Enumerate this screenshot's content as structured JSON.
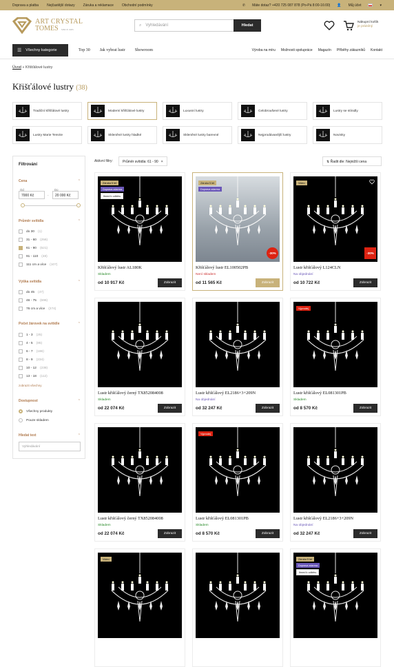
{
  "topbar": {
    "links": [
      "Doprava a platba",
      "Nejčastější dotazy",
      "Záruka a reklamace",
      "Obchodní podmínky"
    ],
    "phone": "Máte dotaz? +420 725 087 878 (Po-Pá 8:00-16:00)",
    "account": "Můj účet",
    "lang": "CZ"
  },
  "logo": {
    "line1": "ART CRYSTAL",
    "line2": "TOMES",
    "since": "SINCE 1985"
  },
  "search": {
    "placeholder": "Vyhledávání",
    "button": "Hledat"
  },
  "cart": {
    "line1": "Nákupní košík",
    "line2": "je prázdný"
  },
  "nav": {
    "categories": "Všechny kategorie",
    "left": [
      "Top 30",
      "Jak vybrat lustr",
      "Showroom"
    ],
    "right": [
      "Výroba na míru",
      "Možnosti spolupráce",
      "Magazín",
      "Příběhy zákazníků",
      "Kontakt"
    ]
  },
  "breadcrumb": {
    "home": "Úvod",
    "sep": " » ",
    "current": "Křišťálové lustry"
  },
  "title": "Křišťálové lustry",
  "count": "(38)",
  "categories": [
    "Tradiční křišťálové lustry",
    "Moderní křišťálové lustry",
    "Luxusní lustry",
    "Celobroušené lustry",
    "Lustry se stínidly",
    "Lustry Marie Terezie",
    "Skleněné lustry hladké",
    "Skleněné lustry barevné",
    "Nejprodávanější lustry",
    "Novinky"
  ],
  "filters": {
    "title": "Filtrování",
    "price": {
      "label": "Cena",
      "from_label": "Od",
      "to_label": "Do",
      "from": "7000 Kč",
      "to": "20 000 Kč"
    },
    "diameter": {
      "label": "Průměr svítidla",
      "options": [
        {
          "l": "do 30",
          "c": "(1)"
        },
        {
          "l": "31 - 60",
          "c": "(256)"
        },
        {
          "l": "61 - 90",
          "c": "(521)"
        },
        {
          "l": "91 - 110",
          "c": "(48)"
        },
        {
          "l": "111 cm a více",
          "c": "(107)"
        }
      ]
    },
    "height": {
      "label": "Výška svítidla",
      "options": [
        {
          "l": "do 45",
          "c": "(47)"
        },
        {
          "l": "46 - 75",
          "c": "(596)"
        },
        {
          "l": "76 cm a více",
          "c": "(274)"
        }
      ]
    },
    "bulbs": {
      "label": "Počet žárovek na svítidle",
      "options": [
        {
          "l": "1 - 3",
          "c": "(25)"
        },
        {
          "l": "4 - 5",
          "c": "(85)"
        },
        {
          "l": "6 - 7",
          "c": "(186)"
        },
        {
          "l": "8 - 9",
          "c": "(234)"
        },
        {
          "l": "10 - 12",
          "c": "(238)"
        },
        {
          "l": "13 - 18",
          "c": "(112)"
        }
      ],
      "show_all": "zobrazit všechny"
    },
    "availability": {
      "label": "Dostupnost",
      "options": [
        "Všechny produkty",
        "Pouze skladem"
      ]
    },
    "text": {
      "label": "Hledat text",
      "placeholder": "Vyhledávání"
    }
  },
  "active": {
    "label": "Aktivní filtry:",
    "chip": "Průměr svítidla: 61 - 90",
    "close": "×",
    "sort": "Řadit dle: Nejnižší cena"
  },
  "products": [
    {
      "name": "Křišťálový lustr AL180K",
      "stock": "Skladem",
      "price": "od 10 917 Kč",
      "btn": "Zobrazit",
      "badges": [
        "Záruka 5 let",
        "Doprava zdarma",
        "Ihned k odběru"
      ]
    },
    {
      "name": "Křišťálový lustr EL100502PB",
      "stock": "Není skladem",
      "price": "od 11 565 Kč",
      "btn": "Zobrazit",
      "badges": [
        "Záruka 5 let",
        "Doprava zdarma"
      ],
      "disc": "-30%"
    },
    {
      "name": "Lustr křišťálový L124CLN",
      "stock": "Na objednání",
      "price": "od 10 722 Kč",
      "btn": "Zobrazit",
      "badges": [
        "Video"
      ],
      "disc": "-30%"
    },
    {
      "name": "Lustr křišťálový černý TX852084008",
      "stock": "Skladem",
      "price": "od 22 074 Kč",
      "btn": "Zobrazit",
      "badges": []
    },
    {
      "name": "Lustr křišťálový EL2186+3+209N",
      "stock": "Na objednání",
      "price": "od 32 247 Kč",
      "btn": "Zobrazit",
      "badges": []
    },
    {
      "name": "Lustr křišťálový EL081301PB",
      "stock": "Skladem",
      "price": "od 8 570 Kč",
      "btn": "Zobrazit",
      "badges": [
        "Výprodej"
      ]
    },
    {
      "name": "Lustr křišťálový černý TX852084008",
      "stock": "Skladem",
      "price": "od 22 074 Kč",
      "btn": "Zobrazit",
      "badges": []
    },
    {
      "name": "Lustr křišťálový EL081301PB",
      "stock": "Skladem",
      "price": "od 8 570 Kč",
      "btn": "Zobrazit",
      "badges": [
        "Výprodej"
      ]
    },
    {
      "name": "Lustr křišťálový EL2186+3+209N",
      "stock": "Na objednání",
      "price": "od 32 247 Kč",
      "btn": "Zobrazit",
      "badges": []
    },
    {
      "badges": [
        "Video"
      ]
    },
    {
      "badges": []
    },
    {
      "badges": [
        "Záruka 5 let",
        "Doprava zdarma",
        "Ihned k odběru"
      ]
    }
  ]
}
